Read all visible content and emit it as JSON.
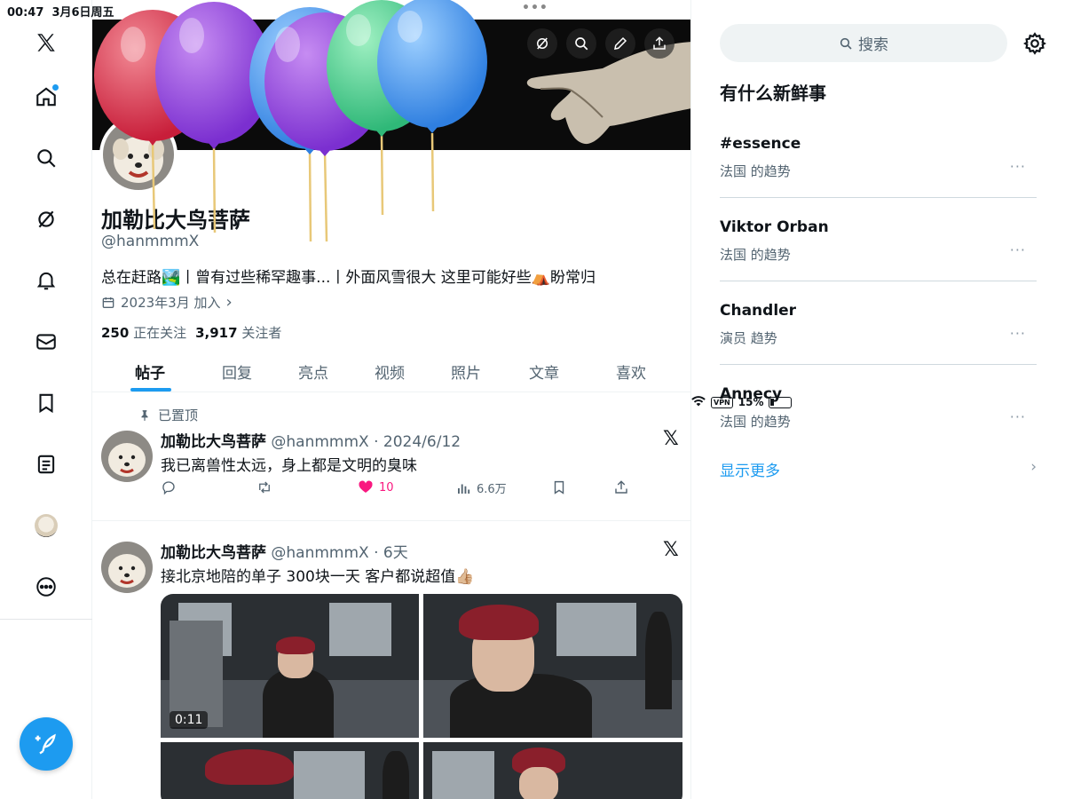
{
  "status_bar": {
    "time": "00:47",
    "date": "3月6日周五",
    "vpn": "VPN",
    "battery": "15%"
  },
  "profile": {
    "display_name": "加勒比大鸟菩萨",
    "handle": "@hanmmmX",
    "bio": "总在赶路🏞️丨曾有过些稀罕趣事...丨外面风雪很大 这里可能好些⛺盼常归",
    "joined": "2023年3月 加入",
    "following_count": "250",
    "following_label": "正在关注",
    "followers_count": "3,917",
    "followers_label": "关注者"
  },
  "tabs": [
    {
      "label": "帖子",
      "active": true
    },
    {
      "label": "回复"
    },
    {
      "label": "亮点"
    },
    {
      "label": "视频"
    },
    {
      "label": "照片"
    },
    {
      "label": "文章"
    },
    {
      "label": "喜欢"
    }
  ],
  "tweets": [
    {
      "pinned_label": "已置顶",
      "name": "加勒比大鸟菩萨",
      "handle_time": "@hanmmmX · 2024/6/12",
      "text": "我已离兽性太远，身上都是文明的臭味",
      "likes": "10",
      "views": "6.6万",
      "source_badge": "𝕏"
    },
    {
      "name": "加勒比大鸟菩萨",
      "handle_time": "@hanmmmX · 6天",
      "text": "接北京地陪的单子 300块一天 客户都说超值👍🏼",
      "video_duration": "0:11",
      "source_badge": "𝕏"
    }
  ],
  "sidebar": {
    "search_placeholder": "搜索",
    "trends_title": "有什么新鲜事",
    "trends": [
      {
        "name": "#essence",
        "meta": "法国 的趋势"
      },
      {
        "name": "Viktor Orban",
        "meta": "法国 的趋势"
      },
      {
        "name": "Chandler",
        "meta": "演员 趋势"
      },
      {
        "name": "Annecy",
        "meta": "法国 的趋势"
      }
    ],
    "show_more": "显示更多",
    "more_glyph": "···",
    "chevron": "›"
  },
  "colors": {
    "accent": "#1d9bf0",
    "like": "#f91880",
    "text_secondary": "#536471"
  },
  "icons": [
    "x-logo-icon",
    "home-icon",
    "search-icon",
    "grok-icon",
    "bell-icon",
    "mail-icon",
    "bookmark-icon",
    "list-icon",
    "avatar",
    "more-circle-icon",
    "compose-icon"
  ]
}
